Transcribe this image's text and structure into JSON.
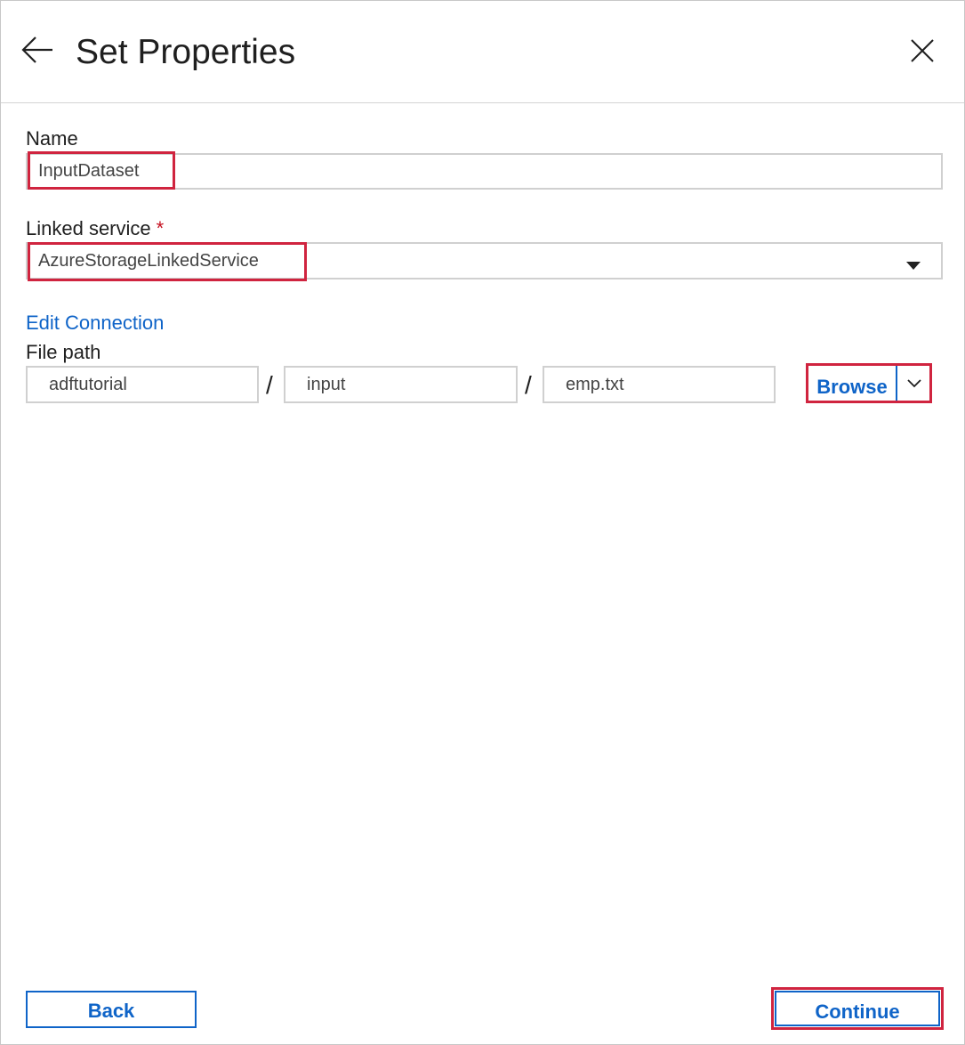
{
  "header": {
    "title": "Set Properties",
    "back_icon": "arrow-left-icon",
    "close_icon": "close-icon"
  },
  "form": {
    "name_label": "Name",
    "name_value": "InputDataset",
    "linked_service_label": "Linked service",
    "linked_service_required": "*",
    "linked_service_value": "AzureStorageLinkedService",
    "edit_connection": "Edit Connection",
    "file_path_label": "File path",
    "file_path": {
      "container": "adftutorial",
      "directory": "input",
      "file": "emp.txt",
      "separator": "/"
    },
    "browse_label": "Browse"
  },
  "footer": {
    "back_label": "Back",
    "continue_label": "Continue"
  },
  "colors": {
    "accent": "#0f64c8",
    "highlight": "#d0243f",
    "required": "#c50f1f"
  }
}
